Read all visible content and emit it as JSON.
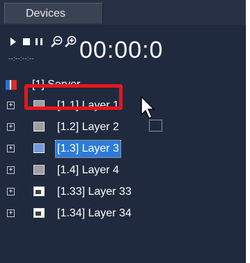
{
  "tabs": {
    "devices": "Devices"
  },
  "toolbar": {
    "timecode": "00:00:0",
    "subtime": "--:--:--:--",
    "buttons": [
      "play-icon",
      "stop-icon",
      "pause-icon",
      "zoom-out-icon",
      "zoom-in-icon"
    ]
  },
  "tree": {
    "server": "[1] Server",
    "layers": [
      {
        "label": "[1.1] Layer 1",
        "icon": "layer-icon"
      },
      {
        "label": "[1.2] Layer 2",
        "icon": "layer-icon"
      },
      {
        "label": "[1.3] Layer 3",
        "icon": "layer-icon",
        "selected": true
      },
      {
        "label": "[1.4] Layer 4",
        "icon": "layer-icon"
      },
      {
        "label": "[1.33] Layer 33",
        "icon": "image-icon"
      },
      {
        "label": "[1.34] Layer 34",
        "icon": "image-icon"
      }
    ],
    "expander": "+"
  },
  "colors": {
    "panel_bg": "#202a3e",
    "selection": "#2d7bd8",
    "highlight": "#e8151d"
  }
}
